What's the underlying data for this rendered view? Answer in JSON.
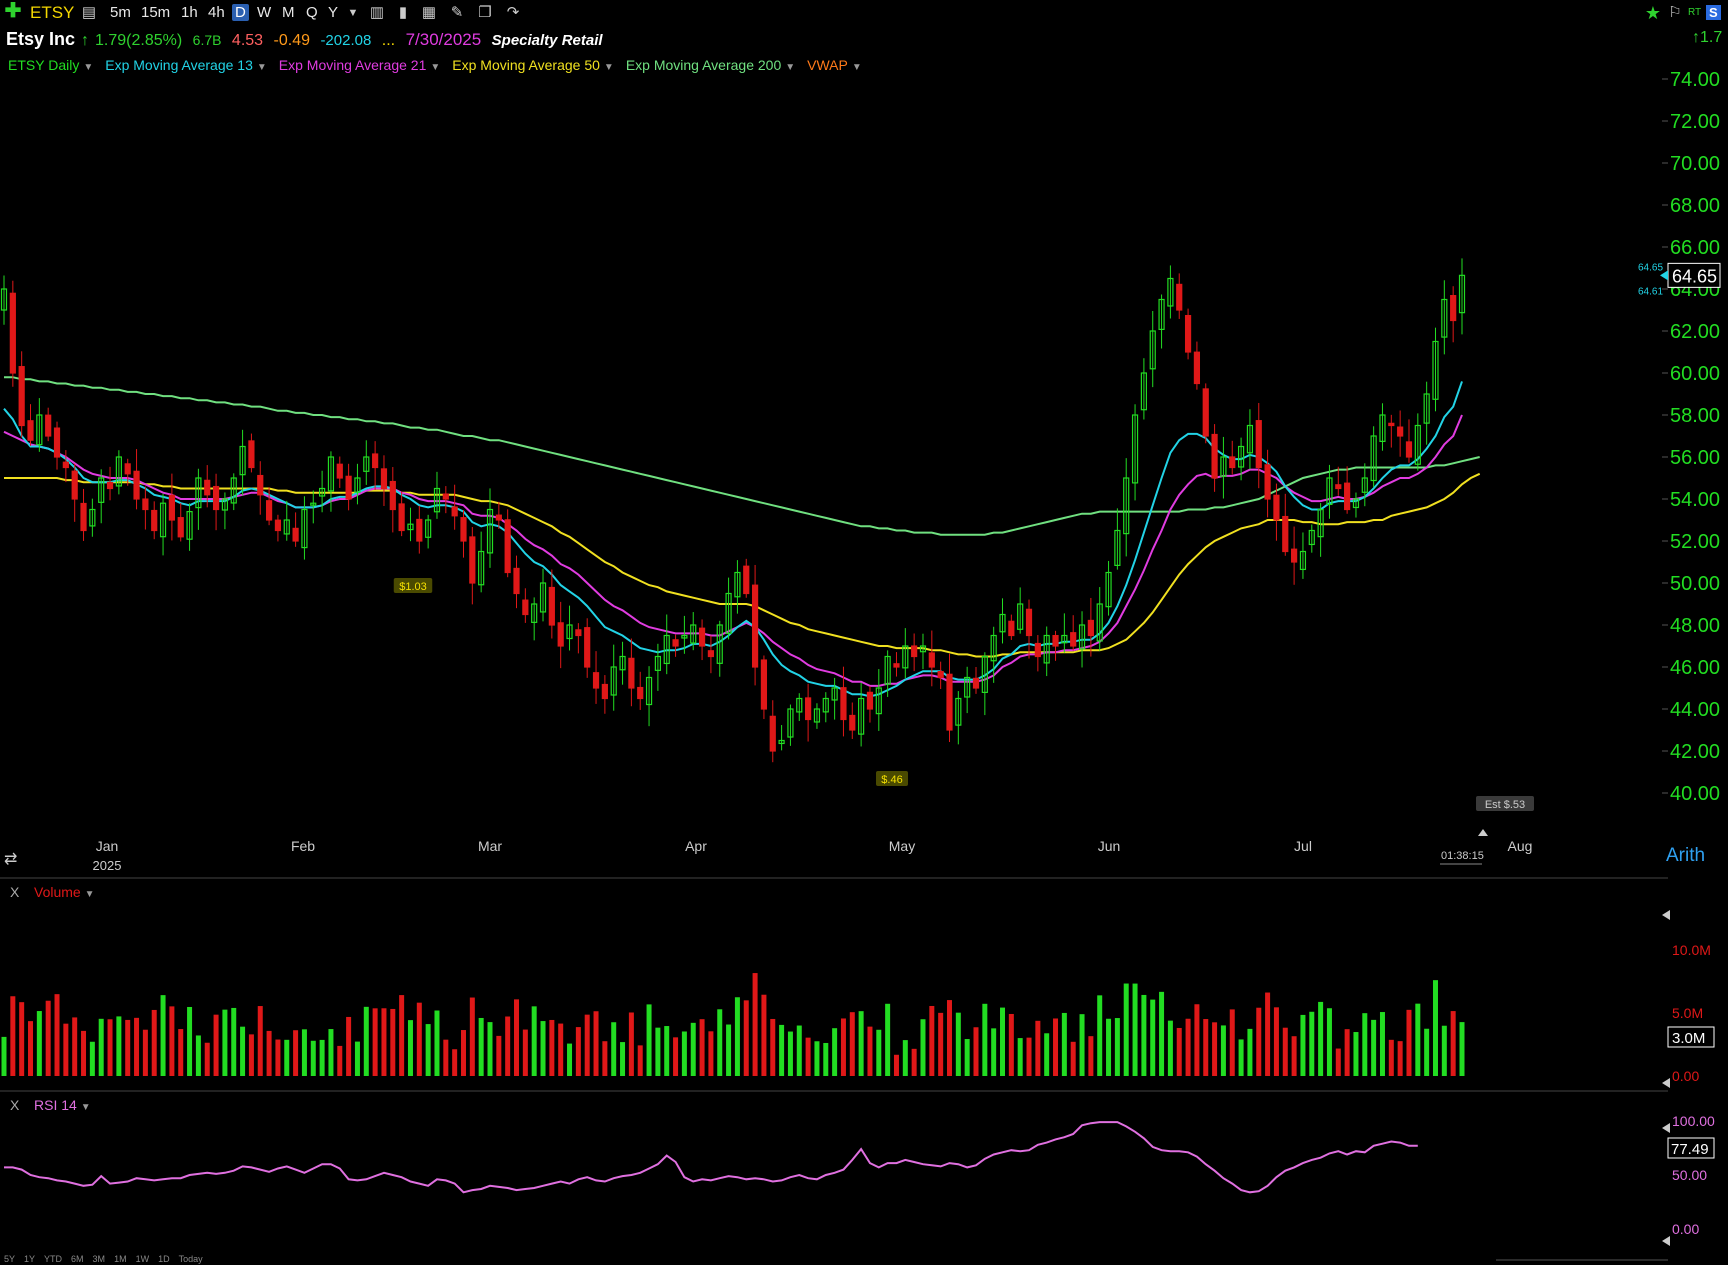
{
  "toolbar": {
    "add_icon": "plus-icon",
    "symbol": "ETSY",
    "intervals": [
      "5m",
      "15m",
      "1h",
      "4h",
      "D",
      "W",
      "M",
      "Q",
      "Y"
    ],
    "selected_interval": "D",
    "right_rt": "RT",
    "right_s": "S"
  },
  "info": {
    "name": "Etsy Inc",
    "change": "1.79(2.85%)",
    "market_cap": "6.7B",
    "v1": "4.53",
    "v2": "-0.49",
    "v3": "-202.08",
    "dots": "...",
    "date": "7/30/2025",
    "industry": "Specialty Retail",
    "right_change": "1.7"
  },
  "legend": [
    {
      "label": "ETSY Daily",
      "color": "#22dd22"
    },
    {
      "label": "Exp Moving Average 13",
      "color": "#22d3e6"
    },
    {
      "label": "Exp Moving Average 21",
      "color": "#e03ce0"
    },
    {
      "label": "Exp Moving Average 50",
      "color": "#f0e020"
    },
    {
      "label": "Exp Moving Average 200",
      "color": "#70e080"
    },
    {
      "label": "VWAP",
      "color": "#ff7a1a"
    }
  ],
  "price_axis": {
    "ticks": [
      "74.00",
      "72.00",
      "70.00",
      "68.00",
      "66.00",
      "64.00",
      "62.00",
      "60.00",
      "58.00",
      "56.00",
      "54.00",
      "52.00",
      "50.00",
      "48.00",
      "46.00",
      "44.00",
      "42.00",
      "40.00"
    ],
    "last": "64.65",
    "small_top": "64.65",
    "small_bottom": "64.61",
    "scale_mode": "Arith"
  },
  "time_axis": {
    "labels": [
      "Jan",
      "Feb",
      "Mar",
      "Apr",
      "May",
      "Jun",
      "Jul",
      "Aug"
    ],
    "year": "2025",
    "countdown": "01:38:15"
  },
  "annotations": {
    "earn1": "$1.03",
    "earn2": "$.46",
    "est": "Est $.53"
  },
  "volume": {
    "close_x": "X",
    "label": "Volume",
    "ticks": [
      "10.0M",
      "5.0M",
      "0.00"
    ],
    "last": "3.0M"
  },
  "rsi": {
    "close_x": "X",
    "label": "RSI 14",
    "ticks": [
      "100.00",
      "50.00",
      "0.00"
    ],
    "last": "77.49"
  },
  "ranges": [
    "5Y",
    "1Y",
    "YTD",
    "6M",
    "3M",
    "1M",
    "1W",
    "1D",
    "Today"
  ],
  "colors": {
    "up": "#22dd22",
    "down": "#e01818",
    "ema13": "#22d3e6",
    "ema21": "#e03ce0",
    "ema50": "#f0e020",
    "ema200": "#70e080",
    "rsi": "#e070e0",
    "axis_green": "#22dd22"
  },
  "chart_data": {
    "type": "candlestick",
    "closes": [
      64.0,
      60.0,
      57.5,
      56.8,
      58.0,
      57.0,
      56.0,
      55.5,
      54.0,
      52.5,
      53.5,
      55.0,
      54.5,
      56.0,
      55.2,
      54.0,
      53.5,
      52.5,
      53.8,
      53.0,
      52.2,
      53.4,
      55.0,
      54.2,
      53.5,
      54.0,
      55.0,
      56.5,
      55.5,
      54.2,
      53.0,
      52.5,
      53.0,
      52.0,
      53.5,
      53.8,
      54.5,
      56.0,
      55.0,
      54.0,
      55.0,
      56.0,
      55.5,
      54.5,
      53.5,
      52.5,
      52.8,
      52.0,
      53.0,
      54.5,
      54.0,
      53.2,
      52.0,
      50.0,
      51.5,
      53.5,
      53.0,
      50.5,
      49.5,
      48.5,
      49.0,
      50.0,
      48.0,
      47.0,
      48.0,
      47.5,
      46.0,
      45.0,
      44.5,
      46.0,
      46.5,
      45.0,
      44.5,
      45.5,
      46.5,
      47.5,
      47.0,
      47.5,
      48.0,
      47.0,
      46.5,
      48.0,
      49.5,
      50.5,
      49.5,
      46.0,
      44.0,
      42.0,
      42.5,
      44.0,
      44.5,
      43.5,
      44.0,
      44.5,
      45.0,
      43.5,
      43.0,
      44.5,
      44.0,
      45.0,
      46.5,
      46.0,
      47.0,
      46.5,
      47.0,
      46.0,
      45.5,
      43.0,
      44.5,
      45.5,
      45.0,
      46.5,
      47.5,
      48.5,
      47.5,
      49.0,
      47.5,
      46.5,
      47.5,
      47.0,
      47.5,
      47.0,
      48.0,
      47.5,
      49.0,
      50.5,
      52.5,
      55.0,
      58.0,
      60.0,
      62.0,
      63.5,
      64.5,
      63.0,
      61.0,
      59.5,
      57.0,
      55.0,
      56.0,
      55.5,
      56.5,
      57.5,
      55.5,
      54.0,
      53.0,
      51.5,
      51.0,
      51.5,
      52.5,
      53.5,
      55.0,
      54.5,
      53.5,
      54.0,
      55.0,
      57.0,
      58.0,
      57.5,
      57.0,
      56.0,
      57.5,
      59.0,
      61.5,
      63.5,
      62.5,
      64.65
    ],
    "ema13": [
      58.3,
      57.8,
      57.0,
      56.5,
      56.5,
      56.4,
      56.2,
      55.9,
      55.5,
      55.0,
      54.8,
      54.8,
      54.8,
      54.9,
      54.9,
      54.7,
      54.5,
      54.2,
      54.1,
      54.0,
      53.8,
      53.7,
      53.9,
      53.9,
      53.9,
      53.9,
      54.1,
      54.4,
      54.5,
      54.4,
      54.2,
      54.0,
      53.8,
      53.6,
      53.6,
      53.6,
      53.7,
      54.0,
      54.1,
      54.1,
      54.3,
      54.5,
      54.6,
      54.6,
      54.5,
      54.2,
      54.0,
      53.7,
      53.6,
      53.7,
      53.7,
      53.6,
      53.4,
      52.9,
      52.7,
      52.8,
      52.7,
      52.4,
      51.9,
      51.4,
      51.0,
      50.8,
      50.4,
      49.9,
      49.6,
      49.3,
      48.9,
      48.4,
      47.9,
      47.7,
      47.5,
      47.2,
      46.9,
      46.8,
      46.7,
      46.8,
      46.8,
      46.9,
      47.1,
      47.1,
      47.0,
      47.2,
      47.5,
      47.9,
      48.2,
      47.9,
      47.3,
      46.6,
      46.1,
      45.8,
      45.6,
      45.3,
      45.2,
      45.1,
      45.1,
      44.9,
      44.7,
      44.7,
      44.6,
      44.7,
      44.9,
      45.1,
      45.4,
      45.6,
      45.8,
      45.8,
      45.8,
      45.5,
      45.4,
      45.4,
      45.4,
      45.6,
      45.9,
      46.4,
      46.6,
      47.0,
      47.1,
      47.0,
      47.1,
      47.1,
      47.2,
      47.2,
      47.3,
      47.3,
      47.6,
      48.1,
      48.9,
      49.9,
      51.1,
      52.4,
      53.7,
      55.0,
      56.2,
      56.8,
      57.1,
      57.1,
      56.9,
      56.4,
      56.1,
      55.9,
      55.9,
      56.1,
      56.0,
      55.7,
      55.3,
      54.6,
      54.1,
      53.7,
      53.5,
      53.5,
      53.8,
      53.9,
      53.9,
      53.9,
      54.1,
      54.5,
      55.0,
      55.4,
      55.6,
      55.6,
      55.9,
      56.4,
      57.0,
      57.9,
      58.4,
      59.6
    ],
    "ema21": [
      57.2,
      57.0,
      56.8,
      56.6,
      56.5,
      56.4,
      56.2,
      56.0,
      55.7,
      55.4,
      55.2,
      55.1,
      55.0,
      55.0,
      55.0,
      54.9,
      54.7,
      54.5,
      54.3,
      54.2,
      54.0,
      54.0,
      54.0,
      54.0,
      54.0,
      54.0,
      54.1,
      54.2,
      54.3,
      54.3,
      54.1,
      53.9,
      53.8,
      53.6,
      53.6,
      53.6,
      53.7,
      53.9,
      54.0,
      54.0,
      54.2,
      54.4,
      54.5,
      54.5,
      54.5,
      54.3,
      54.2,
      54.0,
      53.9,
      53.9,
      53.9,
      53.8,
      53.7,
      53.3,
      53.2,
      53.2,
      53.1,
      52.8,
      52.5,
      52.1,
      51.8,
      51.6,
      51.3,
      50.9,
      50.7,
      50.4,
      50.0,
      49.6,
      49.2,
      48.9,
      48.7,
      48.4,
      48.1,
      47.9,
      47.8,
      47.7,
      47.6,
      47.6,
      47.6,
      47.6,
      47.5,
      47.5,
      47.7,
      47.9,
      48.1,
      47.9,
      47.6,
      47.2,
      46.9,
      46.6,
      46.4,
      46.1,
      45.9,
      45.8,
      45.7,
      45.5,
      45.3,
      45.3,
      45.1,
      45.1,
      45.2,
      45.2,
      45.4,
      45.5,
      45.6,
      45.6,
      45.5,
      45.3,
      45.3,
      45.3,
      45.3,
      45.4,
      45.6,
      46.0,
      46.2,
      46.5,
      46.6,
      46.6,
      46.7,
      46.7,
      46.8,
      46.8,
      46.9,
      47.0,
      47.2,
      47.6,
      48.1,
      48.9,
      49.7,
      50.6,
      51.6,
      52.5,
      53.5,
      54.2,
      54.7,
      55.1,
      55.2,
      55.0,
      55.1,
      55.1,
      55.2,
      55.4,
      55.4,
      55.2,
      55.0,
      54.6,
      54.3,
      54.1,
      53.9,
      53.9,
      54.0,
      54.1,
      54.0,
      54.0,
      54.1,
      54.3,
      54.6,
      54.8,
      55.0,
      55.0,
      55.2,
      55.5,
      56.0,
      56.6,
      57.0,
      58.0
    ],
    "ema50": [
      55.0,
      55.0,
      55.0,
      55.0,
      55.0,
      55.0,
      55.0,
      54.9,
      54.9,
      54.8,
      54.8,
      54.8,
      54.8,
      54.8,
      54.8,
      54.8,
      54.7,
      54.7,
      54.6,
      54.6,
      54.5,
      54.5,
      54.5,
      54.5,
      54.5,
      54.5,
      54.5,
      54.5,
      54.5,
      54.5,
      54.5,
      54.4,
      54.4,
      54.3,
      54.3,
      54.3,
      54.3,
      54.3,
      54.3,
      54.3,
      54.3,
      54.4,
      54.4,
      54.4,
      54.4,
      54.3,
      54.3,
      54.2,
      54.2,
      54.2,
      54.2,
      54.2,
      54.1,
      54.0,
      53.9,
      53.9,
      53.8,
      53.7,
      53.5,
      53.3,
      53.1,
      52.9,
      52.7,
      52.4,
      52.2,
      51.9,
      51.6,
      51.3,
      51.0,
      50.8,
      50.5,
      50.3,
      50.1,
      49.9,
      49.8,
      49.6,
      49.5,
      49.4,
      49.3,
      49.2,
      49.1,
      49.0,
      49.0,
      49.0,
      49.0,
      48.9,
      48.7,
      48.5,
      48.3,
      48.1,
      48.0,
      47.8,
      47.7,
      47.6,
      47.5,
      47.4,
      47.3,
      47.2,
      47.1,
      47.0,
      47.0,
      46.9,
      46.9,
      46.9,
      46.9,
      46.8,
      46.8,
      46.7,
      46.6,
      46.6,
      46.5,
      46.5,
      46.5,
      46.6,
      46.6,
      46.7,
      46.7,
      46.7,
      46.7,
      46.7,
      46.7,
      46.7,
      46.8,
      46.8,
      46.8,
      46.9,
      47.1,
      47.3,
      47.7,
      48.1,
      48.6,
      49.2,
      49.8,
      50.4,
      50.9,
      51.3,
      51.7,
      52.0,
      52.2,
      52.4,
      52.6,
      52.7,
      52.8,
      53.0,
      53.0,
      53.0,
      53.0,
      52.9,
      52.9,
      52.8,
      52.8,
      52.8,
      52.9,
      52.9,
      52.9,
      53.0,
      53.0,
      53.2,
      53.3,
      53.4,
      53.5,
      53.6,
      53.8,
      54.0,
      54.3,
      54.7,
      55.0,
      55.2
    ],
    "ema200": [
      59.8,
      59.8,
      59.7,
      59.7,
      59.6,
      59.6,
      59.5,
      59.5,
      59.4,
      59.4,
      59.3,
      59.3,
      59.2,
      59.2,
      59.1,
      59.1,
      59.0,
      59.0,
      58.9,
      58.9,
      58.8,
      58.8,
      58.7,
      58.7,
      58.6,
      58.6,
      58.5,
      58.5,
      58.4,
      58.4,
      58.3,
      58.2,
      58.2,
      58.1,
      58.1,
      58.0,
      58.0,
      57.9,
      57.9,
      57.8,
      57.8,
      57.7,
      57.7,
      57.6,
      57.6,
      57.5,
      57.4,
      57.4,
      57.3,
      57.3,
      57.2,
      57.1,
      57.0,
      57.0,
      56.9,
      56.8,
      56.8,
      56.7,
      56.6,
      56.5,
      56.4,
      56.3,
      56.2,
      56.1,
      56.0,
      55.9,
      55.8,
      55.7,
      55.6,
      55.5,
      55.4,
      55.3,
      55.2,
      55.1,
      55.0,
      54.9,
      54.8,
      54.7,
      54.6,
      54.5,
      54.4,
      54.3,
      54.2,
      54.1,
      54.0,
      53.9,
      53.8,
      53.7,
      53.6,
      53.5,
      53.4,
      53.3,
      53.2,
      53.1,
      53.0,
      52.9,
      52.8,
      52.7,
      52.7,
      52.6,
      52.6,
      52.5,
      52.5,
      52.4,
      52.4,
      52.4,
      52.3,
      52.3,
      52.3,
      52.3,
      52.3,
      52.3,
      52.4,
      52.4,
      52.5,
      52.6,
      52.7,
      52.8,
      52.9,
      53.0,
      53.1,
      53.2,
      53.3,
      53.3,
      53.4,
      53.4,
      53.4,
      53.4,
      53.4,
      53.4,
      53.4,
      53.4,
      53.4,
      53.4,
      53.5,
      53.5,
      53.5,
      53.6,
      53.6,
      53.7,
      53.8,
      53.9,
      54.0,
      54.2,
      54.4,
      54.6,
      54.8,
      55.0,
      55.1,
      55.2,
      55.3,
      55.4,
      55.4,
      55.5,
      55.5,
      55.5,
      55.5,
      55.5,
      55.5,
      55.5,
      55.5,
      55.5,
      55.6,
      55.6,
      55.7,
      55.8,
      55.9,
      56.0
    ],
    "rsi": [
      57,
      57,
      55,
      50,
      48,
      47,
      45,
      44,
      42,
      40,
      41,
      49,
      42,
      43,
      44,
      47,
      46,
      45,
      46,
      47,
      47,
      50,
      51,
      52,
      51,
      52,
      54,
      58,
      57,
      55,
      53,
      56,
      58,
      55,
      52,
      56,
      60,
      60,
      56,
      46,
      45,
      46,
      49,
      52,
      50,
      48,
      44,
      42,
      40,
      46,
      45,
      42,
      34,
      36,
      37,
      40,
      39,
      38,
      36,
      37,
      38,
      40,
      42,
      44,
      42,
      46,
      48,
      45,
      44,
      47,
      49,
      50,
      52,
      56,
      60,
      68,
      62,
      48,
      44,
      46,
      45,
      47,
      49,
      48,
      46,
      47,
      46,
      44,
      45,
      48,
      50,
      47,
      46,
      50,
      52,
      55,
      64,
      74,
      61,
      57,
      61,
      61,
      64,
      62,
      60,
      59,
      58,
      61,
      60,
      57,
      59,
      65,
      69,
      71,
      73,
      72,
      73,
      78,
      80,
      83,
      85,
      88,
      96,
      98,
      99,
      99,
      99,
      95,
      90,
      84,
      76,
      73,
      72,
      72,
      71,
      67,
      60,
      54,
      47,
      42,
      36,
      34,
      35,
      40,
      48,
      54,
      57,
      61,
      64,
      66,
      70,
      72,
      69,
      72,
      71,
      77,
      79,
      81,
      80,
      77,
      77
    ]
  }
}
